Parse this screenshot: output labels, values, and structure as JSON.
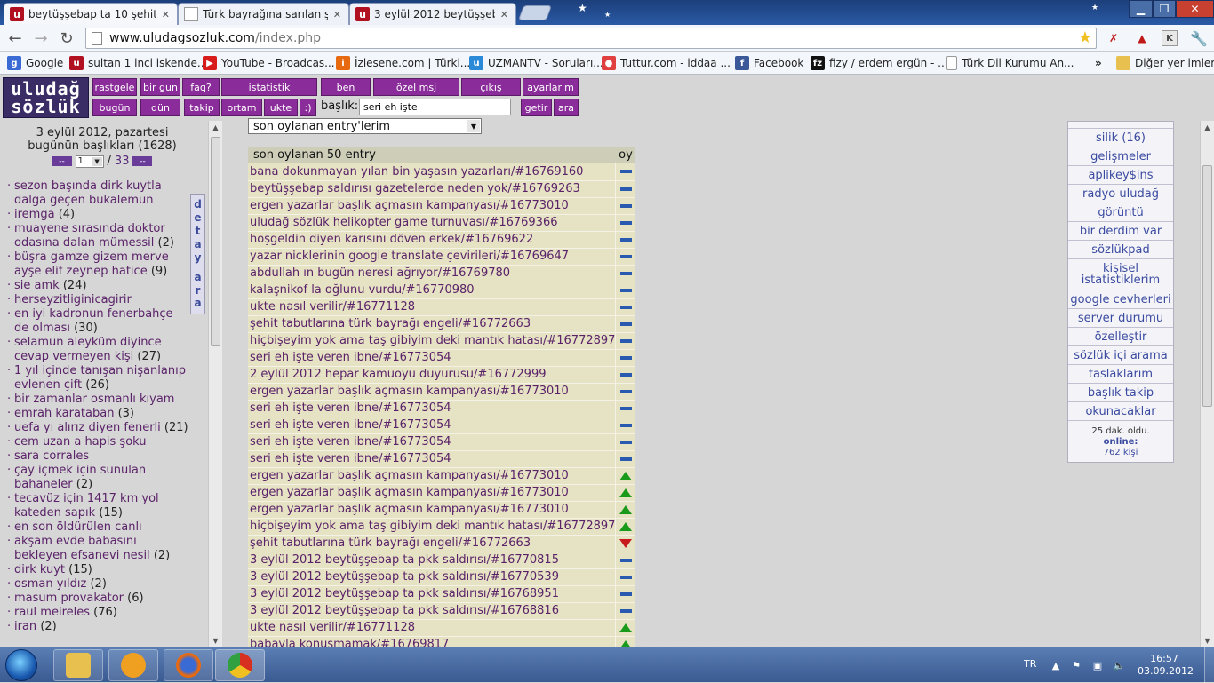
{
  "browser": {
    "tabs": [
      {
        "title": "beytüşşebap ta 10 şehit old",
        "active": true,
        "icon": "uludag-icon"
      },
      {
        "title": "Türk bayrağına sarılan şehi",
        "active": false,
        "icon": "page-icon"
      },
      {
        "title": "3 eylül 2012 beytüşşebap ta",
        "active": false,
        "icon": "uludag-icon"
      }
    ],
    "url_host": "www.uludagsozluk.com",
    "url_path": "/index.php",
    "bookmarks": [
      {
        "label": "Google",
        "icon": "google-icon",
        "color": "#3a6ad4"
      },
      {
        "label": "sultan 1 inci iskende...",
        "icon": "uludag-icon",
        "color": "#b01020"
      },
      {
        "label": "YouTube - Broadcas...",
        "icon": "youtube-icon",
        "color": "#d81c1c"
      },
      {
        "label": "İzlesene.com | Türki...",
        "icon": "izlesene-icon",
        "color": "#e86a10"
      },
      {
        "label": "UZMANTV - Soruları...",
        "icon": "uzmantv-icon",
        "color": "#2a8ad8"
      },
      {
        "label": "Tuttur.com - iddaa ...",
        "icon": "tuttur-icon",
        "color": "#e04040"
      },
      {
        "label": "Facebook",
        "icon": "facebook-icon",
        "color": "#3b5998"
      },
      {
        "label": "fizy / erdem ergün - ...",
        "icon": "fizy-icon",
        "color": "#111111"
      },
      {
        "label": "Türk Dil Kurumu An...",
        "icon": "page-icon",
        "color": "#ffffff"
      }
    ],
    "bookmarks_more": "»",
    "other_bookmarks": "Diğer yer imleri"
  },
  "site": {
    "logo_line1": "uludağ",
    "logo_line2": "sözlük",
    "menu_top": [
      "rastgele",
      "bir gun",
      "faq?",
      "istatistik",
      "ben",
      "özel msj",
      "çıkış",
      "ayarlarım"
    ],
    "menu_bottom": [
      "bugün",
      "dün",
      "takip",
      "ortam",
      "ukte",
      ":)"
    ],
    "search_label": "başlık:",
    "search_value": "seri eh işte",
    "search_go": "getir",
    "search_find": "ara"
  },
  "left": {
    "date": "3 eylül 2012, pazartesi",
    "today_count": "bugünün başlıkları (1628)",
    "prev": "--",
    "page_value": "1",
    "page_sep": "/",
    "page_total": "33",
    "next": "--",
    "detay": [
      "d",
      "e",
      "t",
      "a",
      "y"
    ],
    "ara": [
      "a",
      "r",
      "a"
    ],
    "topics": [
      {
        "title": "sezon başında dirk kuytla dalga geçen bukalemun",
        "count": ""
      },
      {
        "title": "iremga",
        "count": "(4)"
      },
      {
        "title": "muayene sırasında doktor odasına dalan mümessil",
        "count": "(2)"
      },
      {
        "title": "büşra gamze gizem merve ayşe elif zeynep hatice",
        "count": "(9)"
      },
      {
        "title": "sie amk",
        "count": "(24)"
      },
      {
        "title": "herseyzitliginicagirir",
        "count": ""
      },
      {
        "title": "en iyi kadronun fenerbahçe de olması",
        "count": "(30)"
      },
      {
        "title": "selamun aleyküm diyince cevap vermeyen kişi",
        "count": "(27)"
      },
      {
        "title": "1 yıl içinde tanışan nişanlanıp evlenen çift",
        "count": "(26)"
      },
      {
        "title": "bir zamanlar osmanlı kıyam",
        "count": ""
      },
      {
        "title": "emrah karataban",
        "count": "(3)"
      },
      {
        "title": "uefa yı alırız diyen fenerli",
        "count": "(21)"
      },
      {
        "title": "cem uzan a hapis şoku",
        "count": ""
      },
      {
        "title": "sara corrales",
        "count": ""
      },
      {
        "title": "çay içmek için sunulan bahaneler",
        "count": "(2)"
      },
      {
        "title": "tecavüz için 1417 km yol kateden sapık",
        "count": "(15)"
      },
      {
        "title": "en son öldürülen canlı",
        "count": ""
      },
      {
        "title": "akşam evde babasını bekleyen efsanevi nesil",
        "count": "(2)"
      },
      {
        "title": "dirk kuyt",
        "count": "(15)"
      },
      {
        "title": "osman yıldız",
        "count": "(2)"
      },
      {
        "title": "masum provakator",
        "count": "(6)"
      },
      {
        "title": "raul meireles",
        "count": "(76)"
      },
      {
        "title": "iran",
        "count": "(2)"
      }
    ]
  },
  "center": {
    "sort_selected": "son oylanan entry'lerim",
    "table_header": "son oylanan 50 entry",
    "vote_header": "oy",
    "entries": [
      {
        "text": "bana dokunmayan yılan bin yaşasın yazarları/#16769160",
        "vote": "neutral"
      },
      {
        "text": "beytüşşebap saldırısı gazetelerde neden yok/#16769263",
        "vote": "neutral"
      },
      {
        "text": "ergen yazarlar başlık açmasın kampanyası/#16773010",
        "vote": "neutral"
      },
      {
        "text": "uludağ sözlük helikopter game turnuvası/#16769366",
        "vote": "neutral"
      },
      {
        "text": "hoşgeldin diyen karısını döven erkek/#16769622",
        "vote": "neutral"
      },
      {
        "text": "yazar nicklerinin google translate çevirileri/#16769647",
        "vote": "neutral"
      },
      {
        "text": "abdullah ın bugün neresi ağrıyor/#16769780",
        "vote": "neutral"
      },
      {
        "text": "kalaşnikof la oğlunu vurdu/#16770980",
        "vote": "neutral"
      },
      {
        "text": "ukte nasıl verilir/#16771128",
        "vote": "neutral"
      },
      {
        "text": "şehit tabutlarına türk bayrağı engeli/#16772663",
        "vote": "neutral"
      },
      {
        "text": "hiçbişeyim yok ama taş gibiyim deki mantık hatası/#16772897",
        "vote": "neutral"
      },
      {
        "text": "seri eh işte veren ibne/#16773054",
        "vote": "neutral"
      },
      {
        "text": "2 eylül 2012 hepar kamuoyu duyurusu/#16772999",
        "vote": "neutral"
      },
      {
        "text": "ergen yazarlar başlık açmasın kampanyası/#16773010",
        "vote": "neutral"
      },
      {
        "text": "seri eh işte veren ibne/#16773054",
        "vote": "neutral"
      },
      {
        "text": "seri eh işte veren ibne/#16773054",
        "vote": "neutral"
      },
      {
        "text": "seri eh işte veren ibne/#16773054",
        "vote": "neutral"
      },
      {
        "text": "seri eh işte veren ibne/#16773054",
        "vote": "neutral"
      },
      {
        "text": "ergen yazarlar başlık açmasın kampanyası/#16773010",
        "vote": "up"
      },
      {
        "text": "ergen yazarlar başlık açmasın kampanyası/#16773010",
        "vote": "up"
      },
      {
        "text": "ergen yazarlar başlık açmasın kampanyası/#16773010",
        "vote": "up"
      },
      {
        "text": "hiçbişeyim yok ama taş gibiyim deki mantık hatası/#16772897",
        "vote": "up"
      },
      {
        "text": "şehit tabutlarına türk bayrağı engeli/#16772663",
        "vote": "down"
      },
      {
        "text": "3 eylül 2012 beytüşşebap ta pkk saldırısı/#16770815",
        "vote": "neutral"
      },
      {
        "text": "3 eylül 2012 beytüşşebap ta pkk saldırısı/#16770539",
        "vote": "neutral"
      },
      {
        "text": "3 eylül 2012 beytüşşebap ta pkk saldırısı/#16768951",
        "vote": "neutral"
      },
      {
        "text": "3 eylül 2012 beytüşşebap ta pkk saldırısı/#16768816",
        "vote": "neutral"
      },
      {
        "text": "ukte nasıl verilir/#16771128",
        "vote": "up"
      },
      {
        "text": "babayla konuşmamak/#16769817",
        "vote": "up"
      }
    ]
  },
  "right": {
    "links": [
      "silik (16)",
      "gelişmeler",
      "aplikey$ins",
      "radyo uludağ",
      "görüntü",
      "bir derdim var",
      "sözlükpad",
      "kişisel istatistiklerim",
      "google cevherleri",
      "server durumu",
      "özelleştir",
      "sözlük içi arama",
      "taslaklarım",
      "başlık takip",
      "okunacaklar"
    ],
    "online_time": "25 dak. oldu.",
    "online_label": "online:",
    "online_count": "762 kişi"
  },
  "taskbar": {
    "lang": "TR",
    "time": "16:57",
    "date": "03.09.2012"
  },
  "colors": {
    "menu": "#8a2d9a",
    "logo": "#3a2d66",
    "link": "#5a2268",
    "vote_neutral": "#2a5ab0",
    "vote_up": "#1a9a1a",
    "vote_down": "#c81a1a"
  }
}
